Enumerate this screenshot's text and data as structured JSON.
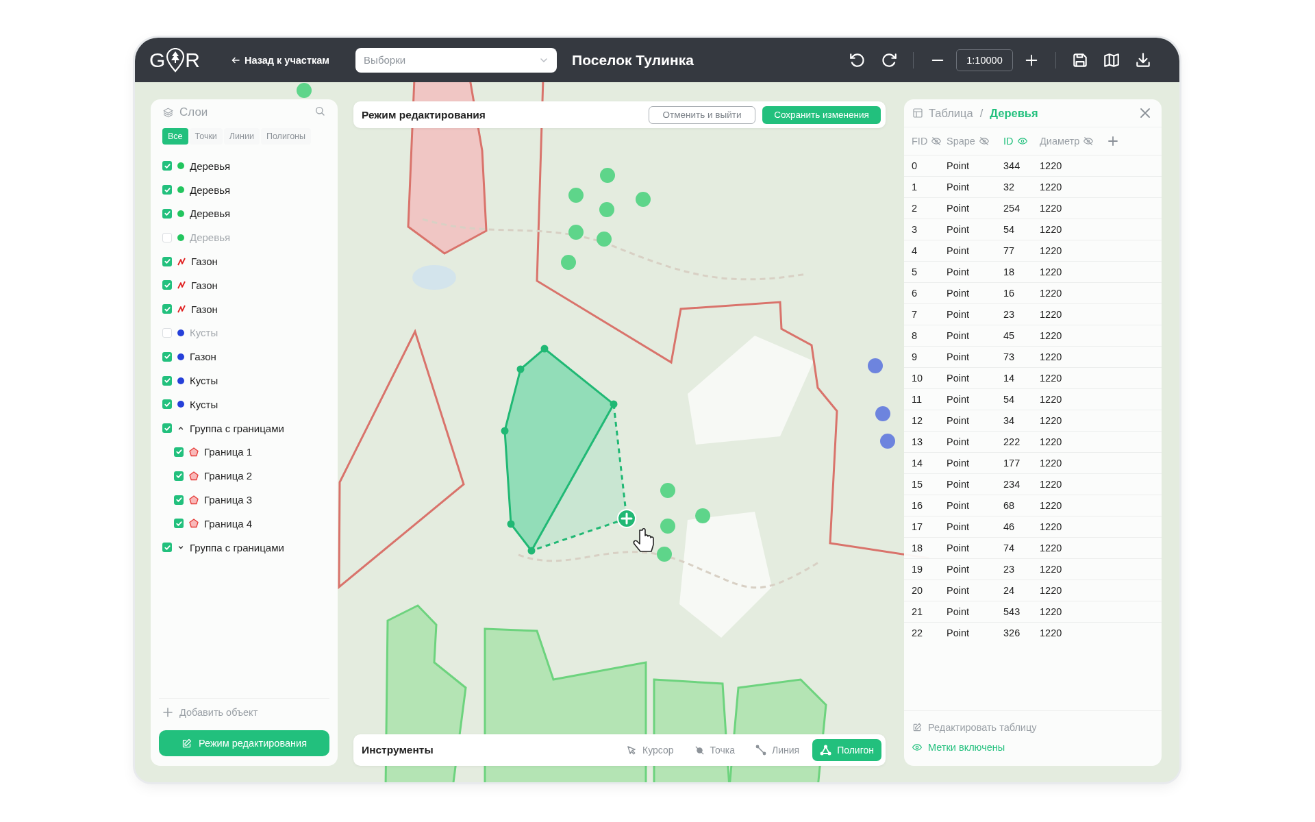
{
  "top_bar": {
    "logo": {
      "left": "G",
      "right": "R"
    },
    "back_link": "Назад к участкам",
    "selection_dropdown": {
      "placeholder": "Выборки"
    },
    "title": "Поселок Тулинка",
    "scale": "1:10000"
  },
  "layers_panel": {
    "title": "Слои",
    "filters": [
      {
        "label": "Все",
        "selected": true
      },
      {
        "label": "Точки",
        "selected": false
      },
      {
        "label": "Линии",
        "selected": false
      },
      {
        "label": "Полигоны",
        "selected": false
      }
    ],
    "layers": [
      {
        "label": "Деревья",
        "kind": "point",
        "checked": true,
        "color": "#22c55e"
      },
      {
        "label": "Деревья",
        "kind": "point",
        "checked": true,
        "color": "#22c55e"
      },
      {
        "label": "Деревья",
        "kind": "point",
        "checked": true,
        "color": "#22c55e"
      },
      {
        "label": "Деревья",
        "kind": "point",
        "checked": false,
        "color": "#22c55e"
      },
      {
        "label": "Газон",
        "kind": "line",
        "checked": true,
        "color": "#e01e1e"
      },
      {
        "label": "Газон",
        "kind": "line",
        "checked": true,
        "color": "#e01e1e"
      },
      {
        "label": "Газон",
        "kind": "line",
        "checked": true,
        "color": "#e01e1e"
      },
      {
        "label": "Кусты",
        "kind": "point",
        "checked": false,
        "color": "#2540d9"
      },
      {
        "label": "Газон",
        "kind": "point",
        "checked": true,
        "color": "#2540d9"
      },
      {
        "label": "Кусты",
        "kind": "point",
        "checked": true,
        "color": "#2540d9"
      },
      {
        "label": "Кусты",
        "kind": "point",
        "checked": true,
        "color": "#2540d9"
      },
      {
        "label": "Группа с границами",
        "kind": "group",
        "checked": true,
        "expanded": true,
        "children": [
          {
            "label": "Граница 1",
            "kind": "polygon",
            "checked": true,
            "color": "#e53935"
          },
          {
            "label": "Граница 2",
            "kind": "polygon",
            "checked": true,
            "color": "#e53935"
          },
          {
            "label": "Граница 3",
            "kind": "polygon",
            "checked": true,
            "color": "#e53935"
          },
          {
            "label": "Граница 4",
            "kind": "polygon",
            "checked": true,
            "color": "#e53935"
          }
        ]
      },
      {
        "label": "Группа с границами",
        "kind": "group",
        "checked": true,
        "expanded": false
      }
    ],
    "add_object": "Добавить объект",
    "edit_mode_button": "Режим редактирования"
  },
  "edit_bar": {
    "title": "Режим редактирования",
    "cancel_button": "Отменить и выйти",
    "save_button": "Сохранить изменения"
  },
  "table_panel": {
    "title": "Таблица",
    "separator": "/",
    "layer": "Деревья",
    "columns": [
      {
        "label": "FID",
        "visible": false
      },
      {
        "label": "Spape",
        "visible": false
      },
      {
        "label": "ID",
        "visible": true
      },
      {
        "label": "Диаметр",
        "visible": false
      }
    ],
    "rows": [
      [
        "0",
        "Point",
        "344",
        "1220"
      ],
      [
        "1",
        "Point",
        "32",
        "1220"
      ],
      [
        "2",
        "Point",
        "254",
        "1220"
      ],
      [
        "3",
        "Point",
        "54",
        "1220"
      ],
      [
        "4",
        "Point",
        "77",
        "1220"
      ],
      [
        "5",
        "Point",
        "18",
        "1220"
      ],
      [
        "6",
        "Point",
        "16",
        "1220"
      ],
      [
        "7",
        "Point",
        "23",
        "1220"
      ],
      [
        "8",
        "Point",
        "45",
        "1220"
      ],
      [
        "9",
        "Point",
        "73",
        "1220"
      ],
      [
        "10",
        "Point",
        "14",
        "1220"
      ],
      [
        "11",
        "Point",
        "54",
        "1220"
      ],
      [
        "12",
        "Point",
        "34",
        "1220"
      ],
      [
        "13",
        "Point",
        "222",
        "1220"
      ],
      [
        "14",
        "Point",
        "177",
        "1220"
      ],
      [
        "15",
        "Point",
        "234",
        "1220"
      ],
      [
        "16",
        "Point",
        "68",
        "1220"
      ],
      [
        "17",
        "Point",
        "46",
        "1220"
      ],
      [
        "18",
        "Point",
        "74",
        "1220"
      ],
      [
        "19",
        "Point",
        "23",
        "1220"
      ],
      [
        "20",
        "Point",
        "24",
        "1220"
      ],
      [
        "21",
        "Point",
        "543",
        "1220"
      ],
      [
        "22",
        "Point",
        "326",
        "1220"
      ]
    ],
    "edit_table": "Редактировать таблицу",
    "labels_toggle": {
      "label": "Метки включены",
      "on": true
    }
  },
  "tools_bar": {
    "title": "Инструменты",
    "tools": [
      {
        "label": "Курсор",
        "kind": "cursor",
        "selected": false
      },
      {
        "label": "Точка",
        "kind": "point",
        "selected": false
      },
      {
        "label": "Линия",
        "kind": "line",
        "selected": false
      },
      {
        "label": "Полигон",
        "kind": "polygon",
        "selected": true
      }
    ]
  }
}
